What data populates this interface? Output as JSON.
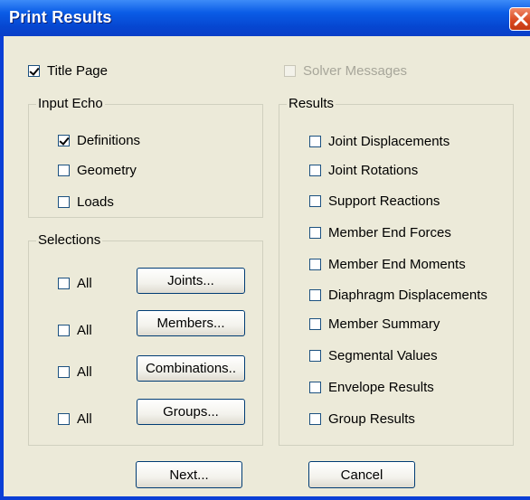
{
  "window": {
    "title": "Print Results"
  },
  "title_page": {
    "label": "Title Page",
    "checked": true
  },
  "solver_messages": {
    "label": "Solver Messages",
    "checked": false,
    "enabled": false
  },
  "input_echo": {
    "label": "Input Echo",
    "items": [
      {
        "label": "Definitions",
        "checked": true
      },
      {
        "label": "Geometry",
        "checked": false
      },
      {
        "label": "Loads",
        "checked": false
      }
    ]
  },
  "selections": {
    "label": "Selections",
    "rows": [
      {
        "all_label": "All",
        "button_label": "Joints..."
      },
      {
        "all_label": "All",
        "button_label": "Members..."
      },
      {
        "all_label": "All",
        "button_label": "Combinations.."
      },
      {
        "all_label": "All",
        "button_label": "Groups..."
      }
    ]
  },
  "results": {
    "label": "Results",
    "items": [
      {
        "label": "Joint Displacements",
        "checked": false
      },
      {
        "label": "Joint Rotations",
        "checked": false
      },
      {
        "label": "Support Reactions",
        "checked": false
      },
      {
        "label": "Member End Forces",
        "checked": false
      },
      {
        "label": "Member End Moments",
        "checked": false
      },
      {
        "label": "Diaphragm Displacements",
        "checked": false
      },
      {
        "label": "Member Summary",
        "checked": false
      },
      {
        "label": "Segmental Values",
        "checked": false
      },
      {
        "label": "Envelope Results",
        "checked": false
      },
      {
        "label": "Group Results",
        "checked": false
      }
    ]
  },
  "footer": {
    "next_label": "Next...",
    "cancel_label": "Cancel"
  }
}
